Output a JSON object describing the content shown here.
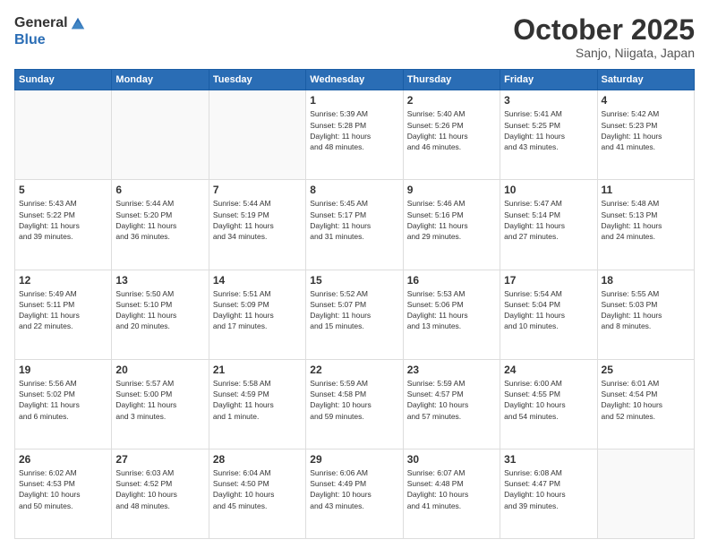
{
  "header": {
    "logo_general": "General",
    "logo_blue": "Blue",
    "month_title": "October 2025",
    "location": "Sanjo, Niigata, Japan"
  },
  "days_of_week": [
    "Sunday",
    "Monday",
    "Tuesday",
    "Wednesday",
    "Thursday",
    "Friday",
    "Saturday"
  ],
  "weeks": [
    [
      {
        "day": "",
        "info": ""
      },
      {
        "day": "",
        "info": ""
      },
      {
        "day": "",
        "info": ""
      },
      {
        "day": "1",
        "info": "Sunrise: 5:39 AM\nSunset: 5:28 PM\nDaylight: 11 hours\nand 48 minutes."
      },
      {
        "day": "2",
        "info": "Sunrise: 5:40 AM\nSunset: 5:26 PM\nDaylight: 11 hours\nand 46 minutes."
      },
      {
        "day": "3",
        "info": "Sunrise: 5:41 AM\nSunset: 5:25 PM\nDaylight: 11 hours\nand 43 minutes."
      },
      {
        "day": "4",
        "info": "Sunrise: 5:42 AM\nSunset: 5:23 PM\nDaylight: 11 hours\nand 41 minutes."
      }
    ],
    [
      {
        "day": "5",
        "info": "Sunrise: 5:43 AM\nSunset: 5:22 PM\nDaylight: 11 hours\nand 39 minutes."
      },
      {
        "day": "6",
        "info": "Sunrise: 5:44 AM\nSunset: 5:20 PM\nDaylight: 11 hours\nand 36 minutes."
      },
      {
        "day": "7",
        "info": "Sunrise: 5:44 AM\nSunset: 5:19 PM\nDaylight: 11 hours\nand 34 minutes."
      },
      {
        "day": "8",
        "info": "Sunrise: 5:45 AM\nSunset: 5:17 PM\nDaylight: 11 hours\nand 31 minutes."
      },
      {
        "day": "9",
        "info": "Sunrise: 5:46 AM\nSunset: 5:16 PM\nDaylight: 11 hours\nand 29 minutes."
      },
      {
        "day": "10",
        "info": "Sunrise: 5:47 AM\nSunset: 5:14 PM\nDaylight: 11 hours\nand 27 minutes."
      },
      {
        "day": "11",
        "info": "Sunrise: 5:48 AM\nSunset: 5:13 PM\nDaylight: 11 hours\nand 24 minutes."
      }
    ],
    [
      {
        "day": "12",
        "info": "Sunrise: 5:49 AM\nSunset: 5:11 PM\nDaylight: 11 hours\nand 22 minutes."
      },
      {
        "day": "13",
        "info": "Sunrise: 5:50 AM\nSunset: 5:10 PM\nDaylight: 11 hours\nand 20 minutes."
      },
      {
        "day": "14",
        "info": "Sunrise: 5:51 AM\nSunset: 5:09 PM\nDaylight: 11 hours\nand 17 minutes."
      },
      {
        "day": "15",
        "info": "Sunrise: 5:52 AM\nSunset: 5:07 PM\nDaylight: 11 hours\nand 15 minutes."
      },
      {
        "day": "16",
        "info": "Sunrise: 5:53 AM\nSunset: 5:06 PM\nDaylight: 11 hours\nand 13 minutes."
      },
      {
        "day": "17",
        "info": "Sunrise: 5:54 AM\nSunset: 5:04 PM\nDaylight: 11 hours\nand 10 minutes."
      },
      {
        "day": "18",
        "info": "Sunrise: 5:55 AM\nSunset: 5:03 PM\nDaylight: 11 hours\nand 8 minutes."
      }
    ],
    [
      {
        "day": "19",
        "info": "Sunrise: 5:56 AM\nSunset: 5:02 PM\nDaylight: 11 hours\nand 6 minutes."
      },
      {
        "day": "20",
        "info": "Sunrise: 5:57 AM\nSunset: 5:00 PM\nDaylight: 11 hours\nand 3 minutes."
      },
      {
        "day": "21",
        "info": "Sunrise: 5:58 AM\nSunset: 4:59 PM\nDaylight: 11 hours\nand 1 minute."
      },
      {
        "day": "22",
        "info": "Sunrise: 5:59 AM\nSunset: 4:58 PM\nDaylight: 10 hours\nand 59 minutes."
      },
      {
        "day": "23",
        "info": "Sunrise: 5:59 AM\nSunset: 4:57 PM\nDaylight: 10 hours\nand 57 minutes."
      },
      {
        "day": "24",
        "info": "Sunrise: 6:00 AM\nSunset: 4:55 PM\nDaylight: 10 hours\nand 54 minutes."
      },
      {
        "day": "25",
        "info": "Sunrise: 6:01 AM\nSunset: 4:54 PM\nDaylight: 10 hours\nand 52 minutes."
      }
    ],
    [
      {
        "day": "26",
        "info": "Sunrise: 6:02 AM\nSunset: 4:53 PM\nDaylight: 10 hours\nand 50 minutes."
      },
      {
        "day": "27",
        "info": "Sunrise: 6:03 AM\nSunset: 4:52 PM\nDaylight: 10 hours\nand 48 minutes."
      },
      {
        "day": "28",
        "info": "Sunrise: 6:04 AM\nSunset: 4:50 PM\nDaylight: 10 hours\nand 45 minutes."
      },
      {
        "day": "29",
        "info": "Sunrise: 6:06 AM\nSunset: 4:49 PM\nDaylight: 10 hours\nand 43 minutes."
      },
      {
        "day": "30",
        "info": "Sunrise: 6:07 AM\nSunset: 4:48 PM\nDaylight: 10 hours\nand 41 minutes."
      },
      {
        "day": "31",
        "info": "Sunrise: 6:08 AM\nSunset: 4:47 PM\nDaylight: 10 hours\nand 39 minutes."
      },
      {
        "day": "",
        "info": ""
      }
    ]
  ]
}
